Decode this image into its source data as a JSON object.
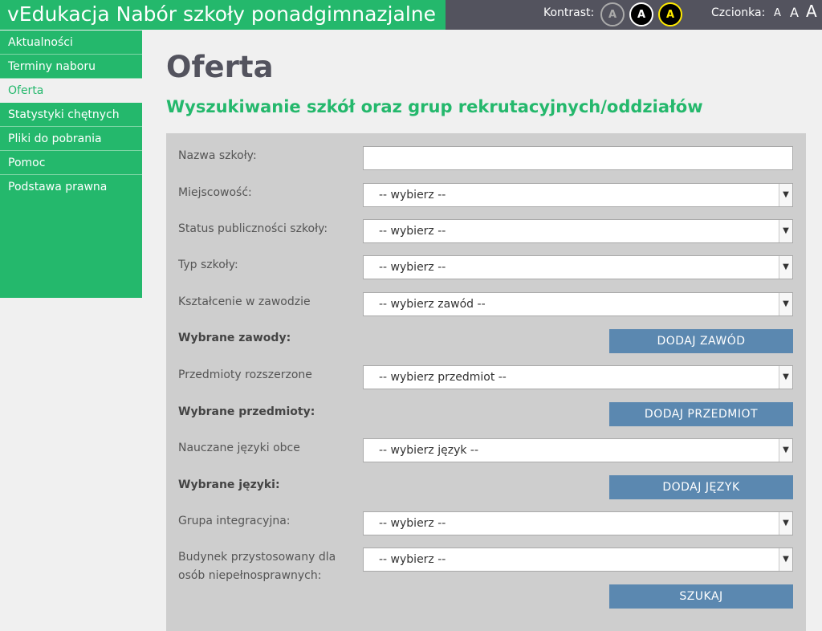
{
  "header": {
    "title": "vEdukacja Nabór szkoły ponadgimnazjalne",
    "contrast_label": "Kontrast:",
    "contrast_options": [
      "A",
      "A",
      "A"
    ],
    "font_label": "Czcionka:",
    "font_sizes": [
      "A",
      "A",
      "A"
    ]
  },
  "sidebar": {
    "items": [
      {
        "label": "Aktualności"
      },
      {
        "label": "Terminy naboru"
      },
      {
        "label": "Oferta"
      },
      {
        "label": "Statystyki chętnych"
      },
      {
        "label": "Pliki do pobrania"
      },
      {
        "label": "Pomoc"
      },
      {
        "label": "Podstawa prawna"
      }
    ]
  },
  "main": {
    "title": "Oferta",
    "subtitle": "Wyszukiwanie szkół oraz grup rekrutacyjnych/oddziałów"
  },
  "form": {
    "school_name_label": "Nazwa szkoły:",
    "school_name_value": "",
    "town_label": "Miejscowość:",
    "town_value": "-- wybierz --",
    "status_label": "Status publiczności szkoły:",
    "status_value": "-- wybierz --",
    "type_label": "Typ szkoły:",
    "type_value": "-- wybierz --",
    "vocational_label": "Kształcenie w zawodzie",
    "vocational_value": "-- wybierz zawód --",
    "selected_professions_label": "Wybrane zawody:",
    "add_profession": "DODAJ ZAWÓD",
    "extended_subjects_label": "Przedmioty rozszerzone",
    "extended_subjects_value": "-- wybierz przedmiot --",
    "selected_subjects_label": "Wybrane przedmioty:",
    "add_subject": "DODAJ PRZEDMIOT",
    "languages_label": "Nauczane języki obce",
    "languages_value": "-- wybierz język --",
    "selected_languages_label": "Wybrane języki:",
    "add_language": "DODAJ JĘZYK",
    "integration_label": "Grupa integracyjna:",
    "integration_value": "-- wybierz --",
    "accessible_label_line1": "Budynek przystosowany dla",
    "accessible_label_line2": "osób niepełnosprawnych:",
    "accessible_value": "-- wybierz --",
    "search_button": "SZUKAJ"
  },
  "colors": {
    "brand_green": "#24b86c",
    "header_gray": "#53535e",
    "button_blue": "#5b88b0",
    "panel_gray": "#cecece"
  }
}
